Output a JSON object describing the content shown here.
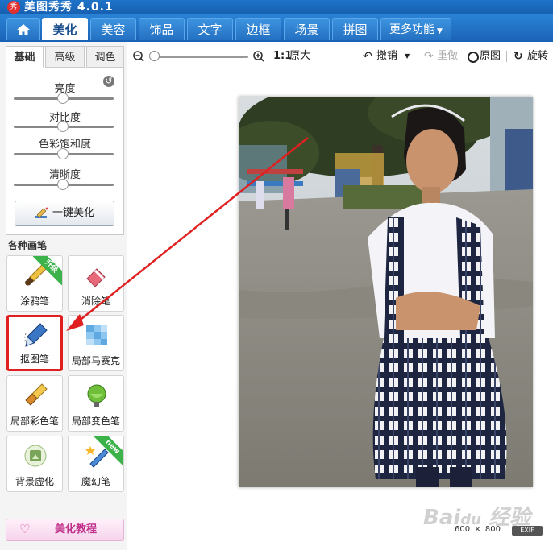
{
  "app": {
    "title": "美图秀秀 4.0.1",
    "logo_text": "秀"
  },
  "nav": {
    "home_icon": "home-icon",
    "tabs": [
      "美化",
      "美容",
      "饰品",
      "文字",
      "边框",
      "场景",
      "拼图",
      "更多功能"
    ]
  },
  "toolbar": {
    "ratio_label": "1:1",
    "original_size_label": "原大",
    "undo_label": "撤销",
    "redo_label": "重做",
    "original_label": "原图",
    "rotate_label": "旋转"
  },
  "adjust": {
    "tabs": [
      "基础",
      "高级",
      "调色"
    ],
    "sliders": [
      {
        "label": "亮度",
        "value": 0.5
      },
      {
        "label": "对比度",
        "value": 0.5
      },
      {
        "label": "色彩饱和度",
        "value": 0.5
      },
      {
        "label": "清晰度",
        "value": 0.5
      }
    ],
    "auto_button": "一键美化"
  },
  "brushes": {
    "heading": "各种画笔",
    "items": [
      {
        "label": "涂鸦笔",
        "badge": "升级"
      },
      {
        "label": "消除笔",
        "badge": ""
      },
      {
        "label": "抠图笔",
        "badge": ""
      },
      {
        "label": "局部马赛克",
        "badge": ""
      },
      {
        "label": "局部彩色笔",
        "badge": ""
      },
      {
        "label": "局部变色笔",
        "badge": ""
      },
      {
        "label": "背景虚化",
        "badge": ""
      },
      {
        "label": "魔幻笔",
        "badge": "new"
      }
    ]
  },
  "tutorial_button": "美化教程",
  "status": {
    "width": "600",
    "sep": "×",
    "height": "800",
    "exif": "EXIF"
  },
  "colors": {
    "accent": "#1a62b6",
    "highlight": "#e02020",
    "badge": "#3bb24a"
  }
}
